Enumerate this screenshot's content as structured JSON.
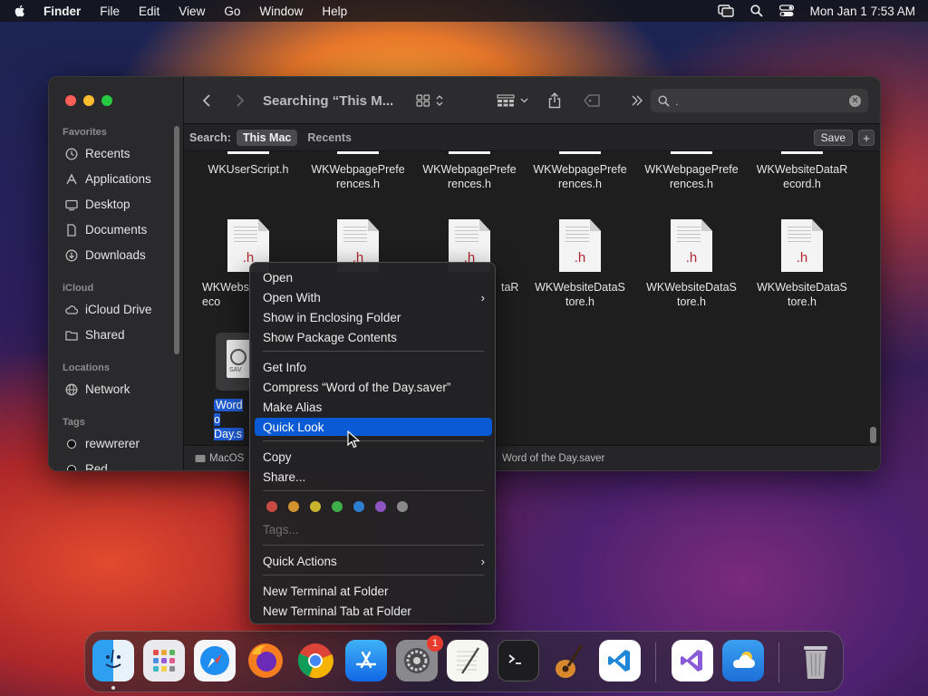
{
  "menubar": {
    "app": "Finder",
    "items": [
      "File",
      "Edit",
      "View",
      "Go",
      "Window",
      "Help"
    ],
    "clock": "Mon Jan 1  7:53 AM"
  },
  "window": {
    "title": "Searching “This M...",
    "search_value": ".",
    "scope": {
      "label": "Search:",
      "this_mac": "This Mac",
      "recents": "Recents",
      "save": "Save",
      "add": "+"
    }
  },
  "sidebar": {
    "favorites_header": "Favorites",
    "favorites": [
      "Recents",
      "Applications",
      "Desktop",
      "Documents",
      "Downloads"
    ],
    "icloud_header": "iCloud",
    "icloud": [
      "iCloud Drive",
      "Shared"
    ],
    "locations_header": "Locations",
    "locations": [
      "Network"
    ],
    "tags_header": "Tags",
    "tags": [
      "rewwrerer",
      "Red"
    ]
  },
  "files": {
    "row1": [
      "WKUserScript.h",
      "WKWebpagePrefe\nrences.h",
      "WKWebpagePrefe\nrences.h",
      "WKWebpagePrefe\nrences.h",
      "WKWebpagePrefe\nrences.h",
      "WKWebsiteDataR\necord.h"
    ],
    "row2": [
      "WKWebs\neco",
      "",
      "taR",
      "WKWebsiteDataS\ntore.h",
      "WKWebsiteDataS\ntore.h",
      "WKWebsiteDataS\ntore.h"
    ],
    "ext": ".h",
    "saver_label": "Word o\nDay.s",
    "saver_icon_text": "SAV"
  },
  "pathbar": {
    "left": "MacOS",
    "right": "Word of the Day.saver"
  },
  "context_menu": {
    "open": "Open",
    "open_with": "Open With",
    "show_enclosing": "Show in Enclosing Folder",
    "show_package": "Show Package Contents",
    "get_info": "Get Info",
    "compress": "Compress “Word of the Day.saver”",
    "make_alias": "Make Alias",
    "quick_look": "Quick Look",
    "copy": "Copy",
    "share": "Share...",
    "tags": "Tags...",
    "quick_actions": "Quick Actions",
    "new_terminal": "New Terminal at Folder",
    "new_terminal_tab": "New Terminal Tab at Folder",
    "tag_colors": [
      "#c94a43",
      "#d2932f",
      "#c9b42f",
      "#3fae4a",
      "#2f7fd0",
      "#8e54c2",
      "#8a8a8a"
    ]
  },
  "dock": {
    "apps": [
      "finder-icon",
      "launchpad-icon",
      "safari-icon",
      "firefox-icon",
      "chrome-icon",
      "app-store-icon",
      "system-settings-icon",
      "textedit-icon",
      "terminal-icon",
      "garageband-icon",
      "vscode-icon",
      "visual-studio-icon",
      "weather-icon",
      "trash-icon"
    ],
    "settings_badge": "1"
  },
  "colors": {
    "selection": "#0a5ad6",
    "accent_red": "#b0282a"
  }
}
